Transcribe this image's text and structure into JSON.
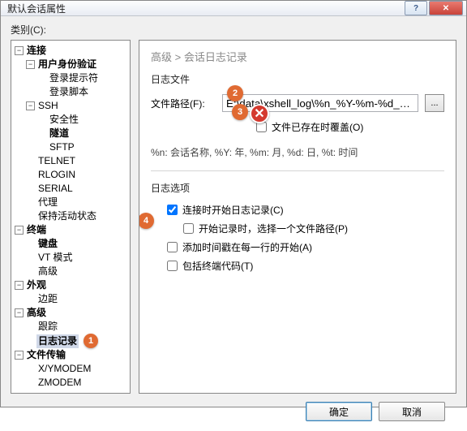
{
  "window": {
    "title": "默认会话属性"
  },
  "category_label": "类别(C):",
  "tree": {
    "conn": "连接",
    "auth": "用户身份验证",
    "login_prompt": "登录提示符",
    "login_script": "登录脚本",
    "ssh": "SSH",
    "security": "安全性",
    "tunnel": "隧道",
    "sftp": "SFTP",
    "telnet": "TELNET",
    "rlogin": "RLOGIN",
    "serial": "SERIAL",
    "proxy": "代理",
    "keepalive": "保持活动状态",
    "terminal": "终端",
    "keyboard": "键盘",
    "vtmode": "VT 模式",
    "adv_term": "高级",
    "appearance": "外观",
    "margin": "边距",
    "advanced": "高级",
    "trace": "跟踪",
    "logging": "日志记录",
    "file_transfer": "文件传输",
    "xymodem": "X/YMODEM",
    "zmodem": "ZMODEM"
  },
  "crumb": "高级 > 会话日志记录",
  "section_logfile": "日志文件",
  "filepath_label": "文件路径(F):",
  "filepath_value": "E:\\data\\xshell_log\\%n_%Y-%m-%d_%t.lo...",
  "browse_label": "...",
  "overwrite_label": "文件已存在时覆盖(O)",
  "hint": "%n: 会话名称, %Y: 年, %m: 月, %d: 日, %t: 时间",
  "section_logopt": "日志选项",
  "opt_start": "连接时开始日志记录(C)",
  "opt_askpath": "开始记录时，选择一个文件路径(P)",
  "opt_timestamp": "添加时间戳在每一行的开始(A)",
  "opt_termcode": "包括终端代码(T)",
  "badges": {
    "b1": "1",
    "b2": "2",
    "b3": "3",
    "b4": "4"
  },
  "buttons": {
    "ok": "确定",
    "cancel": "取消"
  }
}
